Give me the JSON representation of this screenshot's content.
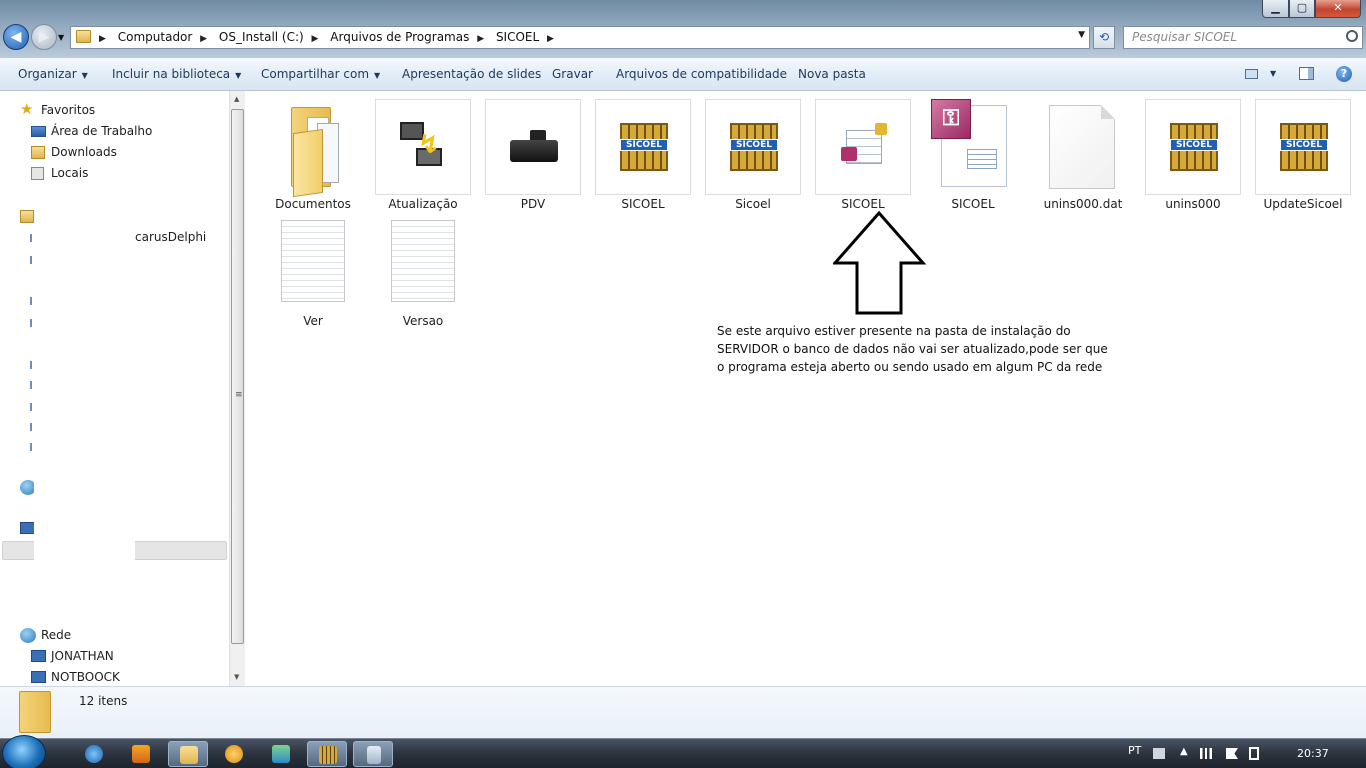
{
  "window": {
    "title": "",
    "minimize_symbol": "▁",
    "maximize_symbol": "▢",
    "close_symbol": "✕"
  },
  "address": {
    "crumbs": [
      "Computador",
      "OS_Install (C:)",
      "Arquivos de Programas",
      "SICOEL"
    ]
  },
  "search": {
    "placeholder": "Pesquisar SICOEL"
  },
  "toolbar": {
    "organize": "Organizar",
    "include_library": "Incluir na biblioteca",
    "share_with": "Compartilhar com",
    "slideshow": "Apresentação de slides",
    "burn": "Gravar",
    "compat_files": "Arquivos de compatibilidade",
    "new_folder": "Nova pasta",
    "help_symbol": "?"
  },
  "navpane": {
    "favorites": "Favoritos",
    "desktop": "Área de Trabalho",
    "downloads": "Downloads",
    "recent": "Locais",
    "partial_item": "carusDelphi",
    "network": "Rede",
    "net_items": [
      "JONATHAN",
      "NOTBOOCK"
    ]
  },
  "files": [
    {
      "name": "Documentos",
      "icon": "folder-icon"
    },
    {
      "name": "Atualização",
      "icon": "update-app-icon"
    },
    {
      "name": "PDV",
      "icon": "cash-register-icon"
    },
    {
      "name": "SICOEL",
      "icon": "sicoel-app-icon"
    },
    {
      "name": "Sicoel",
      "icon": "sicoel-app-icon"
    },
    {
      "name": "SICOEL",
      "icon": "locked-database-icon"
    },
    {
      "name": "SICOEL",
      "icon": "access-database-icon"
    },
    {
      "name": "unins000.dat",
      "icon": "blank-file-icon"
    },
    {
      "name": "unins000",
      "icon": "sicoel-app-icon"
    },
    {
      "name": "UpdateSicoel",
      "icon": "sicoel-app-icon"
    },
    {
      "name": "Ver",
      "icon": "text-file-icon"
    },
    {
      "name": "Versao",
      "icon": "text-file-icon"
    }
  ],
  "logo_text": "SICOEL",
  "annotation": {
    "note": "Se este arquivo estiver presente na pasta de instalação do SERVIDOR o banco de dados não vai ser atualizado,pode ser que o programa esteja aberto ou sendo usado em algum PC da rede"
  },
  "details": {
    "count": "12 itens"
  },
  "taskbar": {
    "language": "PT",
    "clock": "20:37"
  }
}
